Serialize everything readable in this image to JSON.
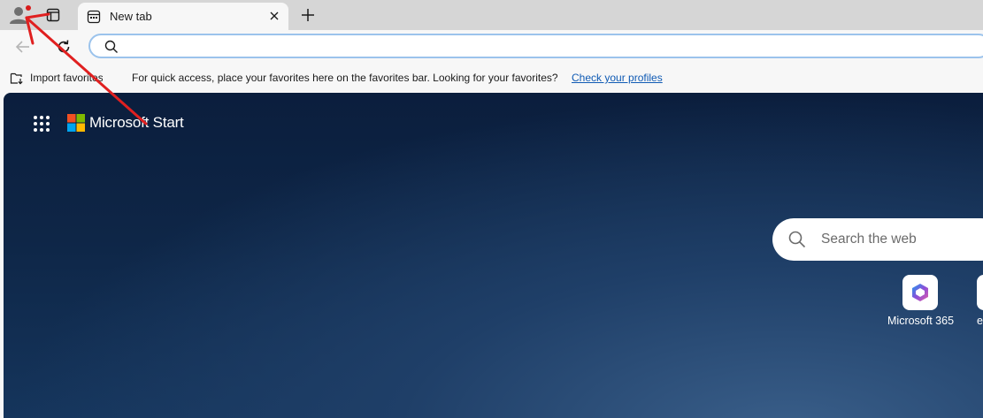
{
  "tab": {
    "title": "New tab"
  },
  "address_bar": {
    "value": "",
    "placeholder": ""
  },
  "favorites_bar": {
    "import_label": "Import favorites",
    "message": "For quick access, place your favorites here on the favorites bar. Looking for your favorites?",
    "link": "Check your profiles"
  },
  "ntp": {
    "brand": "Microsoft Start",
    "search_placeholder": "Search the web",
    "quick_links": [
      {
        "label": "Microsoft 365"
      },
      {
        "label": "e"
      }
    ]
  },
  "colors": {
    "tabstrip": "#d6d6d6",
    "toolbar": "#f7f7f7",
    "link": "#0f5ab4",
    "address_border": "#9bc3ec",
    "ntp_background": "#0e2647",
    "annotation_arrow": "#e02020",
    "notification_dot": "#d81c1c"
  },
  "icons": [
    "profile-icon",
    "tab-actions-icon",
    "new-tab-favicon",
    "close-icon",
    "plus-icon",
    "back-arrow-icon",
    "refresh-icon",
    "search-icon",
    "import-favorites-icon",
    "apps-grid-icon",
    "microsoft-logo-icon",
    "microsoft-365-icon"
  ]
}
